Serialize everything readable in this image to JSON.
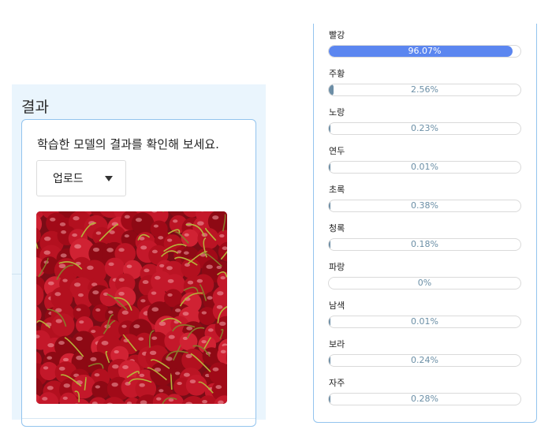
{
  "result_panel": {
    "title": "결과",
    "description": "학습한 모델의 결과를 확인해 보세요.",
    "upload_label": "업로드",
    "upload_icon": "caret-down-icon"
  },
  "accent_color": "#5b86f0",
  "small_fill_color": "#6d8ea6",
  "colors": [
    {
      "label": "빨강",
      "value_text": "96.07%",
      "fraction": 0.9607
    },
    {
      "label": "주황",
      "value_text": "2.56%",
      "fraction": 0.0256
    },
    {
      "label": "노랑",
      "value_text": "0.23%",
      "fraction": 0.0023
    },
    {
      "label": "연두",
      "value_text": "0.01%",
      "fraction": 0.0001
    },
    {
      "label": "초록",
      "value_text": "0.38%",
      "fraction": 0.0038
    },
    {
      "label": "청록",
      "value_text": "0.18%",
      "fraction": 0.0018
    },
    {
      "label": "파랑",
      "value_text": "0%",
      "fraction": 0
    },
    {
      "label": "남색",
      "value_text": "0.01%",
      "fraction": 0.0001
    },
    {
      "label": "보라",
      "value_text": "0.24%",
      "fraction": 0.0024
    },
    {
      "label": "자주",
      "value_text": "0.28%",
      "fraction": 0.0028
    }
  ]
}
